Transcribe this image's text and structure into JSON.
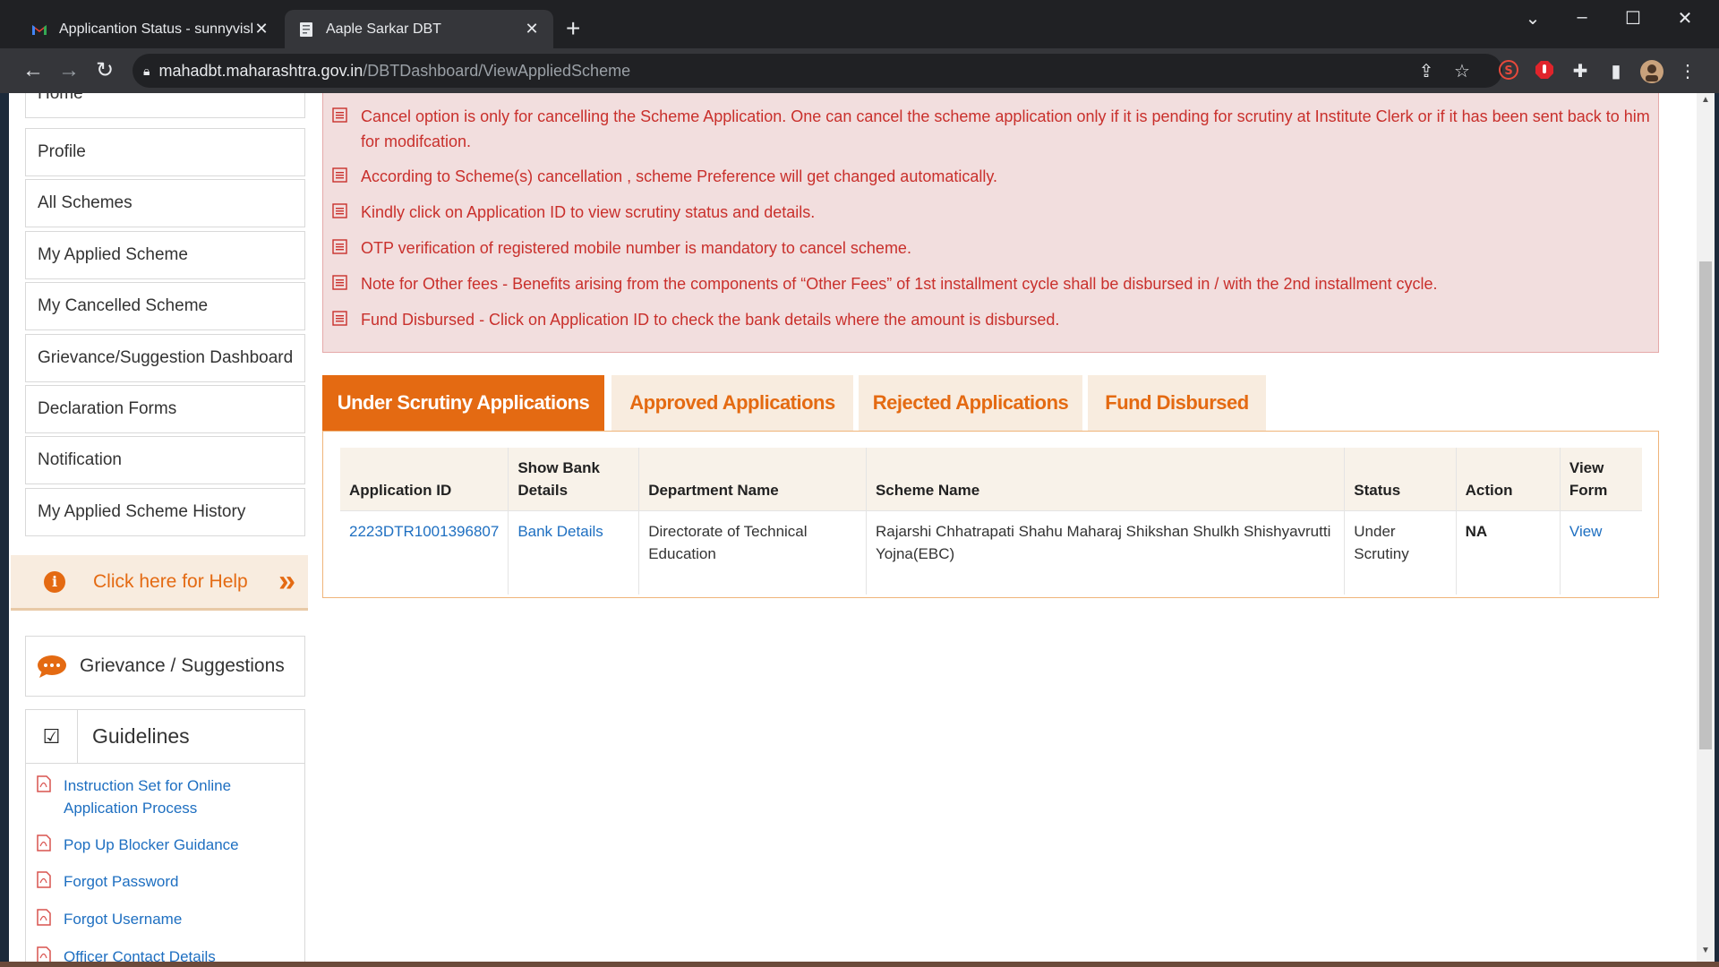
{
  "browser": {
    "tabs": [
      {
        "title": "Applicantion Status - sunnyvishw",
        "active": false,
        "icon": "gmail-icon"
      },
      {
        "title": "Aaple Sarkar DBT",
        "active": true,
        "icon": "document-icon"
      }
    ],
    "url_host": "mahadbt.maharashtra.gov.in",
    "url_path": "/DBTDashboard/ViewAppliedScheme"
  },
  "sidebar": {
    "items": [
      {
        "label": "Home"
      },
      {
        "label": "Profile"
      },
      {
        "label": "All Schemes"
      },
      {
        "label": "My Applied Scheme"
      },
      {
        "label": "My Cancelled Scheme"
      },
      {
        "label": "Grievance/Suggestion Dashboard"
      },
      {
        "label": "Declaration Forms"
      },
      {
        "label": "Notification"
      },
      {
        "label": "My Applied Scheme History"
      }
    ],
    "help_label": "Click here for Help",
    "grievance_label": "Grievance / Suggestions",
    "guidelines_title": "Guidelines",
    "guideline_links": [
      {
        "label": "Instruction Set for Online Application Process"
      },
      {
        "label": "Pop Up Blocker Guidance"
      },
      {
        "label": "Forgot Password"
      },
      {
        "label": "Forgot Username"
      },
      {
        "label": "Officer Contact Details"
      }
    ]
  },
  "notes": [
    "Cancel option is only for cancelling the Scheme Application. One can cancel the scheme application only if it is pending for scrutiny at Institute Clerk or if it has been sent back to him for modifcation.",
    "According to Scheme(s) cancellation , scheme Preference will get changed automatically.",
    "Kindly click on Application ID to view scrutiny status and details.",
    "OTP verification of registered mobile number is mandatory to cancel scheme.",
    "Note for Other fees - Benefits arising from the components of “Other Fees” of 1st installment cycle shall be disbursed in / with the 2nd installment cycle.",
    "Fund Disbursed - Click on Application ID to check the bank details where the amount is disbursed."
  ],
  "app_tabs": [
    {
      "label": "Under Scrutiny Applications",
      "active": true
    },
    {
      "label": "Approved Applications",
      "active": false
    },
    {
      "label": "Rejected Applications",
      "active": false
    },
    {
      "label": "Fund Disbursed",
      "active": false
    }
  ],
  "table": {
    "headers": [
      "Application ID",
      "Show Bank Details",
      "Department Name",
      "Scheme Name",
      "Status",
      "Action",
      "View Form"
    ],
    "rows": [
      {
        "application_id": "2223DTR1001396807",
        "bank_details": "Bank Details",
        "department": "Directorate of Technical Education",
        "scheme": "Rajarshi Chhatrapati Shahu Maharaj Shikshan Shulkh Shishyavrutti Yojna(EBC)",
        "status": "Under Scrutiny",
        "action": "NA",
        "view": "View"
      }
    ]
  },
  "colors": {
    "accent_orange": "#e46a12",
    "note_bg": "#f2dede",
    "note_text": "#c9302c",
    "link_blue": "#1e6fc1"
  }
}
